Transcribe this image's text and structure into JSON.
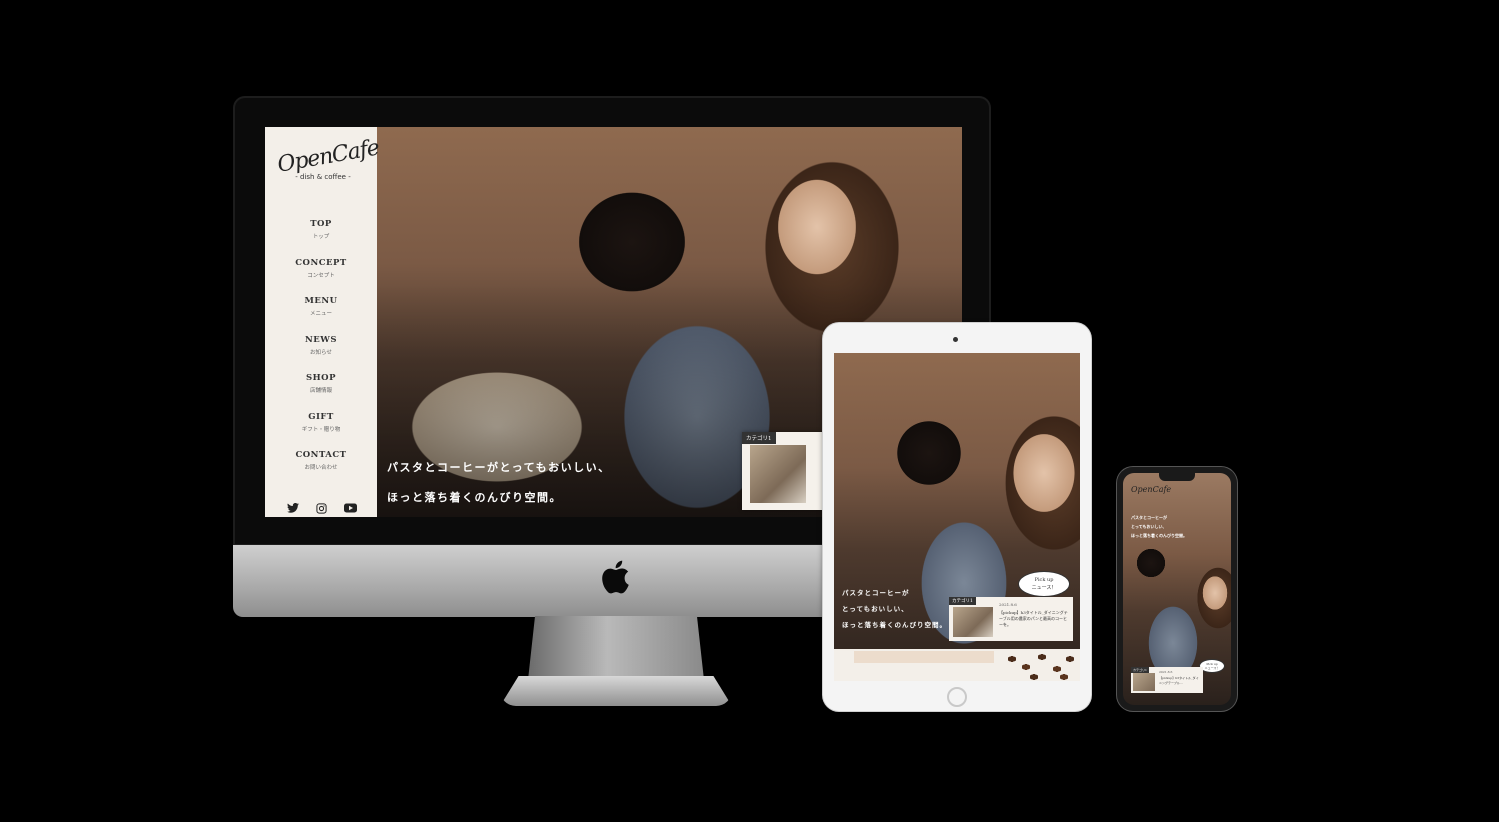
{
  "brand": {
    "name": "OpenCafe",
    "tagline": "- dish & coffee -"
  },
  "nav": [
    {
      "en": "TOP",
      "ja": "トップ"
    },
    {
      "en": "CONCEPT",
      "ja": "コンセプト"
    },
    {
      "en": "MENU",
      "ja": "メニュー"
    },
    {
      "en": "NEWS",
      "ja": "お知らせ"
    },
    {
      "en": "SHOP",
      "ja": "店舗情報"
    },
    {
      "en": "GIFT",
      "ja": "ギフト・贈り物"
    },
    {
      "en": "CONTACT",
      "ja": "お問い合わせ"
    }
  ],
  "social": [
    "twitter-icon",
    "instagram-icon",
    "youtube-icon"
  ],
  "hero": {
    "catch_line1": "パスタとコーヒーがとってもおいしい、",
    "catch_line2": "ほっと落ち着くのんびり空間。",
    "slides_count": 3,
    "active_slide": 3
  },
  "news_card": {
    "category": "カテゴリ1"
  },
  "tablet": {
    "catch_line1": "パスタとコーヒーが",
    "catch_line2": "とってもおいしい、",
    "catch_line3": "ほっと落ち着くのんびり空間。",
    "card_category": "カテゴリ1",
    "card_date": "2021.8.6",
    "card_text": "【pickup】h3タイトル_ダイニングテーブル用の農家のパンと最高のコーヒーを。",
    "bubble_line1": "Pick up",
    "bubble_line2": "ニュース！"
  },
  "phone": {
    "logo": "OpenCafe",
    "catch_line1": "パスタとコーヒーが",
    "catch_line2": "とってもおいしい、",
    "catch_line3": "ほっと落ち着くのんびり空間。",
    "card_category": "カテゴリ1",
    "card_date": "2021.8.6",
    "card_text": "【pickup】h3タイトル_ダイニングテーブル...",
    "bubble_line1": "Pick up",
    "bubble_line2": "ニュース！"
  },
  "colors": {
    "sidebar_bg": "#f3efe9",
    "active_dot": "#e1867a",
    "device_silver": "#a9a9a9"
  }
}
